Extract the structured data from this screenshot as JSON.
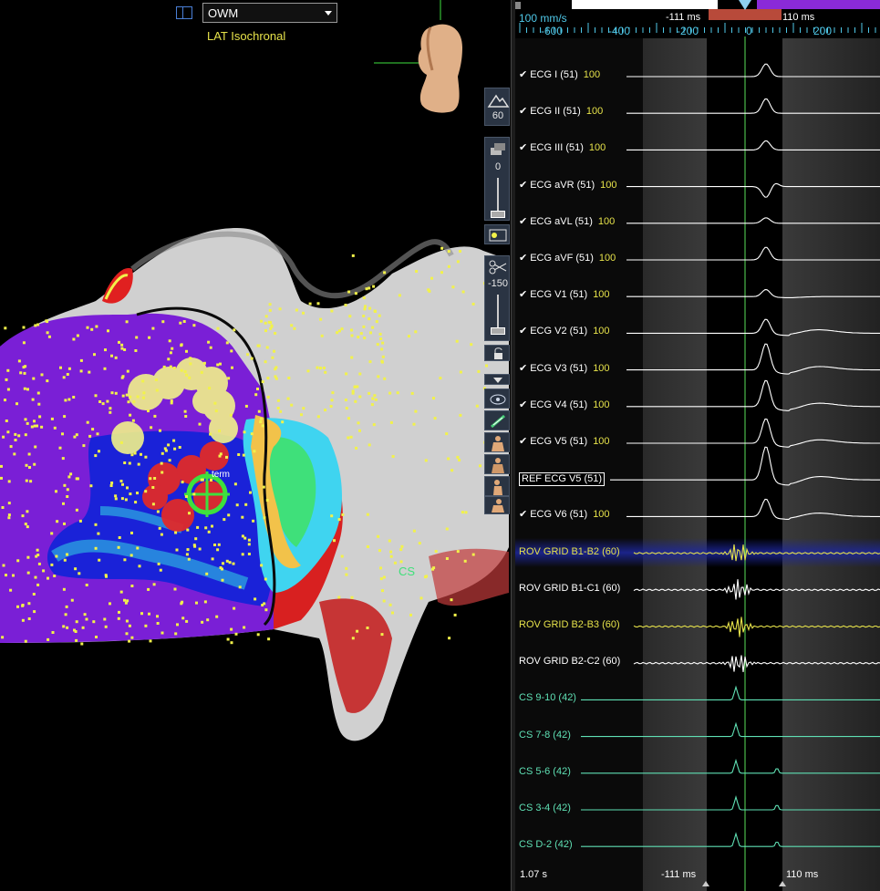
{
  "map": {
    "dropdown_value": "OWM",
    "map_mode": "LAT Isochronal",
    "cs_label": "CS",
    "marker_label": "term",
    "colors": {
      "purple": "#7a1fd6",
      "blue": "#1520d0",
      "cyan": "#3fd4f0",
      "green": "#3fe07a",
      "yellow": "#f2f25a",
      "red": "#e01818",
      "grey": "#cfcfcf",
      "point": "#f2f24a"
    }
  },
  "toolbar": {
    "opacity_value": "60",
    "slider1_value": "0",
    "slider2_value": "-150"
  },
  "ecg": {
    "sweep_speed": "100 mm/s",
    "window_left_label": "-111 ms",
    "window_right_label": "110 ms",
    "ticks": [
      "-600",
      "-400",
      "-200",
      "0",
      "200"
    ],
    "traces": [
      {
        "name": "ECG I (51)",
        "gain": "100",
        "checked": true,
        "color": "white"
      },
      {
        "name": "ECG II (51)",
        "gain": "100",
        "checked": true,
        "color": "white"
      },
      {
        "name": "ECG III (51)",
        "gain": "100",
        "checked": true,
        "color": "white"
      },
      {
        "name": "ECG aVR (51)",
        "gain": "100",
        "checked": true,
        "color": "white"
      },
      {
        "name": "ECG aVL (51)",
        "gain": "100",
        "checked": true,
        "color": "white"
      },
      {
        "name": "ECG aVF (51)",
        "gain": "100",
        "checked": true,
        "color": "white"
      },
      {
        "name": "ECG V1 (51)",
        "gain": "100",
        "checked": true,
        "color": "white"
      },
      {
        "name": "ECG V2 (51)",
        "gain": "100",
        "checked": true,
        "color": "white"
      },
      {
        "name": "ECG V3 (51)",
        "gain": "100",
        "checked": true,
        "color": "white"
      },
      {
        "name": "ECG V4 (51)",
        "gain": "100",
        "checked": true,
        "color": "white"
      },
      {
        "name": "ECG V5 (51)",
        "gain": "100",
        "checked": true,
        "color": "white"
      },
      {
        "name": "REF ECG V5 (51)",
        "gain": "",
        "checked": false,
        "color": "white",
        "boxed": true
      },
      {
        "name": "ECG V6 (51)",
        "gain": "100",
        "checked": true,
        "color": "white"
      },
      {
        "name": "ROV GRID  B1-B2 (60)",
        "gain": "",
        "checked": false,
        "color": "yellow",
        "highlight": true
      },
      {
        "name": "ROV GRID  B1-C1 (60)",
        "gain": "",
        "checked": false,
        "color": "white"
      },
      {
        "name": "ROV GRID  B2-B3 (60)",
        "gain": "",
        "checked": false,
        "color": "yellow"
      },
      {
        "name": "ROV GRID  B2-C2 (60)",
        "gain": "",
        "checked": false,
        "color": "white"
      },
      {
        "name": "CS  9-10 (42)",
        "gain": "",
        "checked": false,
        "color": "green"
      },
      {
        "name": "CS  7-8 (42)",
        "gain": "",
        "checked": false,
        "color": "green"
      },
      {
        "name": "CS  5-6 (42)",
        "gain": "",
        "checked": false,
        "color": "green"
      },
      {
        "name": "CS  3-4 (42)",
        "gain": "",
        "checked": false,
        "color": "green"
      },
      {
        "name": "CS  D-2 (42)",
        "gain": "",
        "checked": false,
        "color": "green"
      }
    ],
    "bottom_time": "1.07 s",
    "bottom_left_label": "-111 ms",
    "bottom_right_label": "110 ms"
  }
}
